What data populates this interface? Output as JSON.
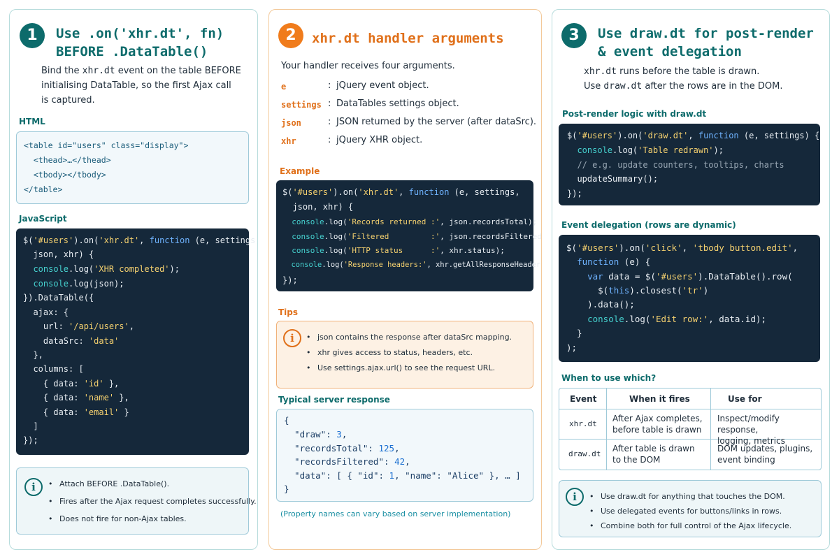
{
  "col1": {
    "number": "1",
    "title_line1": "Use .on('xhr.dt', fn)",
    "title_line2": "BEFORE .DataTable()",
    "desc": {
      "l1a": "Bind the ",
      "l1b": "xhr.dt",
      "l1c": " event on the table BEFORE",
      "l2": "initialising DataTable, so the first Ajax call",
      "l3": "is captured."
    },
    "html_heading": "HTML",
    "html_code": [
      "<table id=\"users\" class=\"display\">",
      "  <thead>…</thead>",
      "  <tbody></tbody>",
      "</table>"
    ],
    "js_heading": "JavaScript",
    "js": {
      "l1a": "$(",
      "l1b": "'#users'",
      "l1c": ").on(",
      "l1d": "'xhr.dt'",
      "l1e": ", ",
      "l1f": "function",
      "l1g": " (e, settings,",
      "l2": "  json, xhr) {",
      "l3a": "  console",
      "l3b": ".log(",
      "l3c": "'XHR completed'",
      "l3d": ");",
      "l4a": "  console",
      "l4b": ".log(json);",
      "l5": "}).DataTable({",
      "l6": "  ajax: {",
      "l7a": "    url: ",
      "l7b": "'/api/users'",
      "l7c": ",",
      "l8a": "    dataSrc: ",
      "l8b": "'data'",
      "l9": "  },",
      "l10": "  columns: [",
      "l11a": "    { data: ",
      "l11b": "'id'",
      "l11c": " },",
      "l12a": "    { data: ",
      "l12b": "'name'",
      "l12c": " },",
      "l13a": "    { data: ",
      "l13b": "'email'",
      "l13c": " }",
      "l14": "  ]",
      "l15": "});"
    },
    "bullets": [
      "Attach BEFORE .DataTable().",
      "Fires after the Ajax request completes successfully.",
      "Does not fire for non-Ajax tables."
    ]
  },
  "col2": {
    "number": "2",
    "title": "xhr.dt handler arguments",
    "intro": "Your handler receives four arguments.",
    "args": [
      {
        "key": "e",
        "colon": ":",
        "desc": "jQuery event object."
      },
      {
        "key": "settings",
        "colon": ":",
        "desc": "DataTables settings object."
      },
      {
        "key": "json",
        "colon": ":",
        "desc": "JSON returned by the server (after dataSrc)."
      },
      {
        "key": "xhr",
        "colon": ":",
        "desc": "jQuery XHR object."
      }
    ],
    "example_heading": "Example",
    "example": {
      "l1a": "$(",
      "l1b": "'#users'",
      "l1c": ").on(",
      "l1d": "'xhr.dt'",
      "l1e": ", ",
      "l1f": "function",
      "l1g": " (e, settings,",
      "l2": "  json, xhr) {",
      "l3a": "  console",
      "l3b": ".log(",
      "l3c": "'Records returned :'",
      "l3d": ", json.recordsTotal);",
      "l4a": "  console",
      "l4b": ".log(",
      "l4c": "'Filtered         :'",
      "l4d": ", json.recordsFiltered);",
      "l5a": "  console",
      "l5b": ".log(",
      "l5c": "'HTTP status      :'",
      "l5d": ", xhr.status);",
      "l6a": "  console",
      "l6b": ".log(",
      "l6c": "'Response headers:'",
      "l6d": ", xhr.getAllResponseHeaders());",
      "l7": "});"
    },
    "tips_heading": "Tips",
    "tips": [
      "json contains the response after dataSrc mapping.",
      "xhr gives access to status, headers, etc.",
      "Use settings.ajax.url() to see the request URL."
    ],
    "server_heading": "Typical server response",
    "server": {
      "l1": "{",
      "l2a": "  \"draw\"",
      "l2b": ": ",
      "l2c": "3",
      "l2d": ",",
      "l3a": "  \"recordsTotal\"",
      "l3b": ": ",
      "l3c": "125",
      "l3d": ",",
      "l4a": "  \"recordsFiltered\"",
      "l4b": ": ",
      "l4c": "42",
      "l4d": ",",
      "l5a": "  \"data\"",
      "l5b": ": [ { ",
      "l5c": "\"id\"",
      "l5d": ": ",
      "l5e": "1",
      "l5f": ", ",
      "l5g": "\"name\"",
      "l5h": ": ",
      "l5i": "\"Alice\"",
      "l5j": " }, … ]",
      "l6": "}"
    },
    "note": "(Property names can vary based on server implementation)"
  },
  "col3": {
    "number": "3",
    "title_line1": "Use draw.dt for post-render",
    "title_line2": "& event delegation",
    "desc": {
      "l1a": "xhr.dt",
      "l1b": " runs before the table is drawn.",
      "l2a": "Use ",
      "l2b": "draw.dt",
      "l2c": " after the rows are in the DOM."
    },
    "post_heading": "Post-render logic with draw.dt",
    "post": {
      "l1a": "$(",
      "l1b": "'#users'",
      "l1c": ").on(",
      "l1d": "'draw.dt'",
      "l1e": ", ",
      "l1f": "function",
      "l1g": " (e, settings) {",
      "l2a": "  console",
      "l2b": ".log(",
      "l2c": "'Table redrawn'",
      "l2d": ");",
      "l3": "  // e.g. update counters, tooltips, charts",
      "l4": "  updateSummary();",
      "l5": "});"
    },
    "deleg_heading": "Event delegation (rows are dynamic)",
    "deleg": {
      "l1a": "$(",
      "l1b": "'#users'",
      "l1c": ").on(",
      "l1d": "'click'",
      "l1e": ", ",
      "l1f": "'tbody button.edit'",
      "l1g": ",",
      "l2a": "  ",
      "l2b": "function",
      "l2c": " (e) {",
      "l3a": "    ",
      "l3b": "var",
      "l3c": " data = $(",
      "l3d": "'#users'",
      "l3e": ").DataTable().row(",
      "l4a": "      $(",
      "l4b": "this",
      "l4c": ").closest(",
      "l4d": "'tr'",
      "l4e": ")",
      "l5": "    ).data();",
      "l6a": "    console",
      "l6b": ".log(",
      "l6c": "'Edit row:'",
      "l6d": ", data.id);",
      "l7": "  }",
      "l8": ");"
    },
    "which_heading": "When to use which?",
    "table": {
      "headers": [
        "Event",
        "When it fires",
        "Use for"
      ],
      "rows": [
        {
          "event": "xhr.dt",
          "when1": "After Ajax completes,",
          "when2": "before table is drawn",
          "use1": "Inspect/modify response,",
          "use2": "logging, metrics"
        },
        {
          "event": "draw.dt",
          "when1": "After table is drawn",
          "when2": "to the DOM",
          "use1": "DOM updates, plugins,",
          "use2": "event binding"
        }
      ]
    },
    "bullets": [
      "Use draw.dt for anything that touches the DOM.",
      "Use delegated events for buttons/links in rows.",
      "Combine both for full control of the Ajax lifecycle."
    ]
  }
}
